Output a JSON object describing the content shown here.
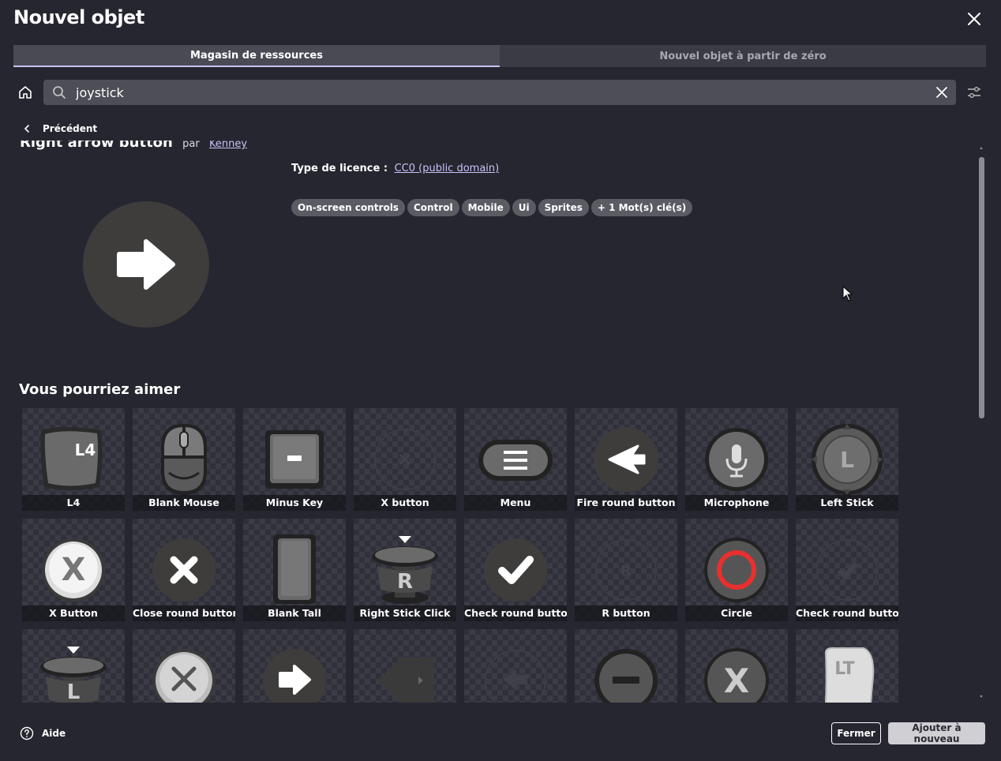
{
  "window": {
    "title": "Nouvel objet"
  },
  "tabs": [
    {
      "label": "Magasin de ressources",
      "active": true
    },
    {
      "label": "Nouvel objet à partir de zéro",
      "active": false
    }
  ],
  "search": {
    "value": "joystick"
  },
  "nav": {
    "back_label": "Précédent"
  },
  "asset": {
    "title": "Right arrow button",
    "by": "par",
    "author": "Kenney",
    "license_label": "Type de licence :",
    "license_value": "CC0 (public domain)",
    "tags": [
      "On-screen controls",
      "Control",
      "Mobile",
      "Ui",
      "Sprites",
      "+ 1 Mot(s) clé(s)"
    ]
  },
  "suggestions": {
    "title": "Vous pourriez aimer",
    "items": [
      {
        "label": "L4",
        "icon": "l4-key-icon"
      },
      {
        "label": "Blank Mouse",
        "icon": "mouse-icon"
      },
      {
        "label": "Minus Key",
        "icon": "minus-key-icon"
      },
      {
        "label": "X button",
        "icon": "x-button-faint-icon"
      },
      {
        "label": "Menu",
        "icon": "menu-button-icon"
      },
      {
        "label": "Fire round button",
        "icon": "fire-round-icon"
      },
      {
        "label": "Microphone",
        "icon": "microphone-icon"
      },
      {
        "label": "Left Stick",
        "icon": "left-stick-icon"
      },
      {
        "label": "X Button",
        "icon": "x-button-white-icon"
      },
      {
        "label": "Close round button",
        "icon": "close-round-icon"
      },
      {
        "label": "Blank Tall",
        "icon": "blank-tall-icon"
      },
      {
        "label": "Right Stick Click",
        "icon": "right-stick-click-icon"
      },
      {
        "label": "Check round button",
        "icon": "check-round-icon"
      },
      {
        "label": "R button",
        "icon": "r-button-faint-icon"
      },
      {
        "label": "Circle",
        "icon": "circle-button-icon"
      },
      {
        "label": "Check round button",
        "icon": "check-round-faint-icon"
      },
      {
        "label": "",
        "icon": "left-stick-click-icon"
      },
      {
        "label": "",
        "icon": "x-button-grey-icon"
      },
      {
        "label": "",
        "icon": "right-arrow-round-icon"
      },
      {
        "label": "",
        "icon": "back-arrow-key-icon"
      },
      {
        "label": "",
        "icon": "left-arrow-faint-icon"
      },
      {
        "label": "",
        "icon": "minus-round-icon"
      },
      {
        "label": "",
        "icon": "x-button-dark-icon"
      },
      {
        "label": "",
        "icon": "lt-trigger-icon"
      }
    ]
  },
  "footer": {
    "help_label": "Aide",
    "close_label": "Fermer",
    "add_label": "Ajouter à nouveau"
  },
  "colors": {
    "accent": "#c9c2f7",
    "background": "#25262f"
  }
}
